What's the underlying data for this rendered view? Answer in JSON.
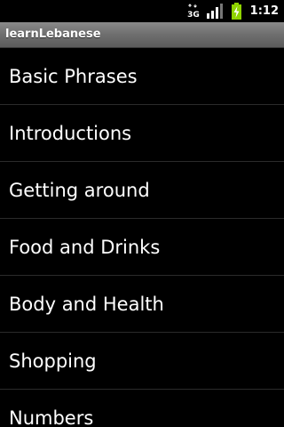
{
  "statusbar": {
    "time": "1:12",
    "network_type": "3G",
    "icons": [
      "3g-data-icon",
      "signal-strength-icon",
      "battery-charging-icon"
    ]
  },
  "app": {
    "title": "learnLebanese"
  },
  "menu": {
    "items": [
      {
        "label": "Basic Phrases"
      },
      {
        "label": "Introductions"
      },
      {
        "label": "Getting around"
      },
      {
        "label": "Food and Drinks"
      },
      {
        "label": "Body and Health"
      },
      {
        "label": "Shopping"
      },
      {
        "label": "Numbers"
      }
    ]
  },
  "colors": {
    "background": "#000000",
    "titlebar": "#6e6e6e",
    "divider": "#2b2b2b",
    "battery": "#8fd400",
    "text": "#ffffff"
  }
}
